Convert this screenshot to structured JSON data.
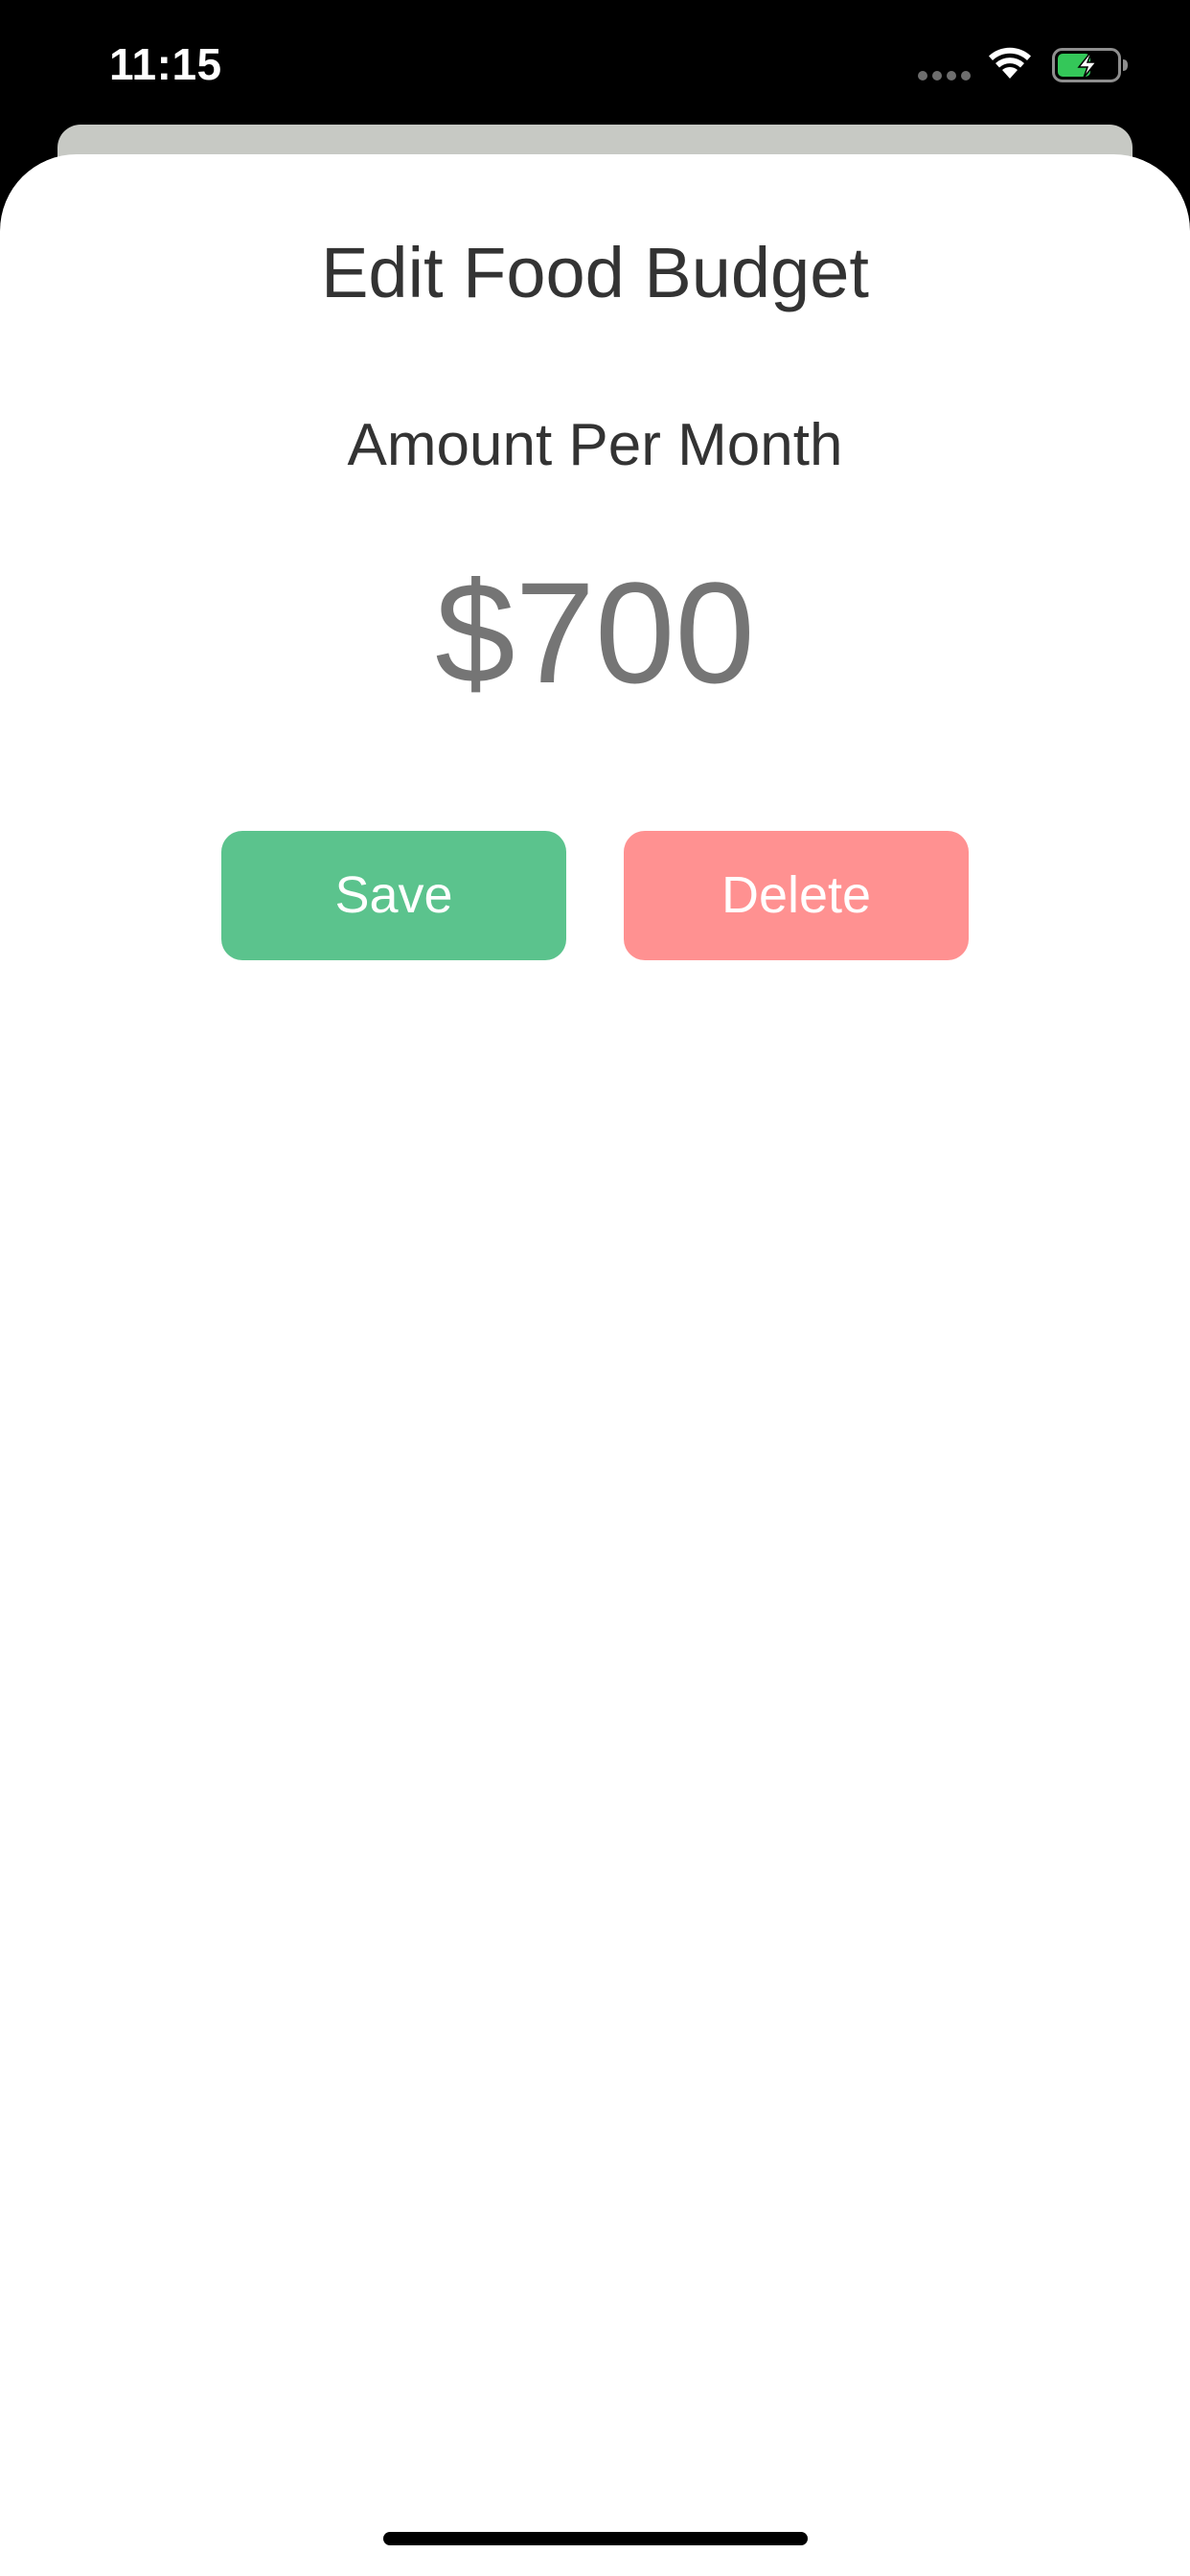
{
  "status_bar": {
    "time": "11:15",
    "signal_icon": "cellular-signal-icon",
    "wifi_icon": "wifi-icon",
    "battery_icon": "battery-charging-icon",
    "battery_color": "#34c759"
  },
  "sheet": {
    "title": "Edit Food Budget",
    "amount_label": "Amount Per Month",
    "amount_value": "$700",
    "save_label": "Save",
    "delete_label": "Delete"
  },
  "colors": {
    "save_button": "#5bc38d",
    "delete_button": "#ff9191",
    "title_text": "#333333",
    "amount_text": "#757575"
  }
}
